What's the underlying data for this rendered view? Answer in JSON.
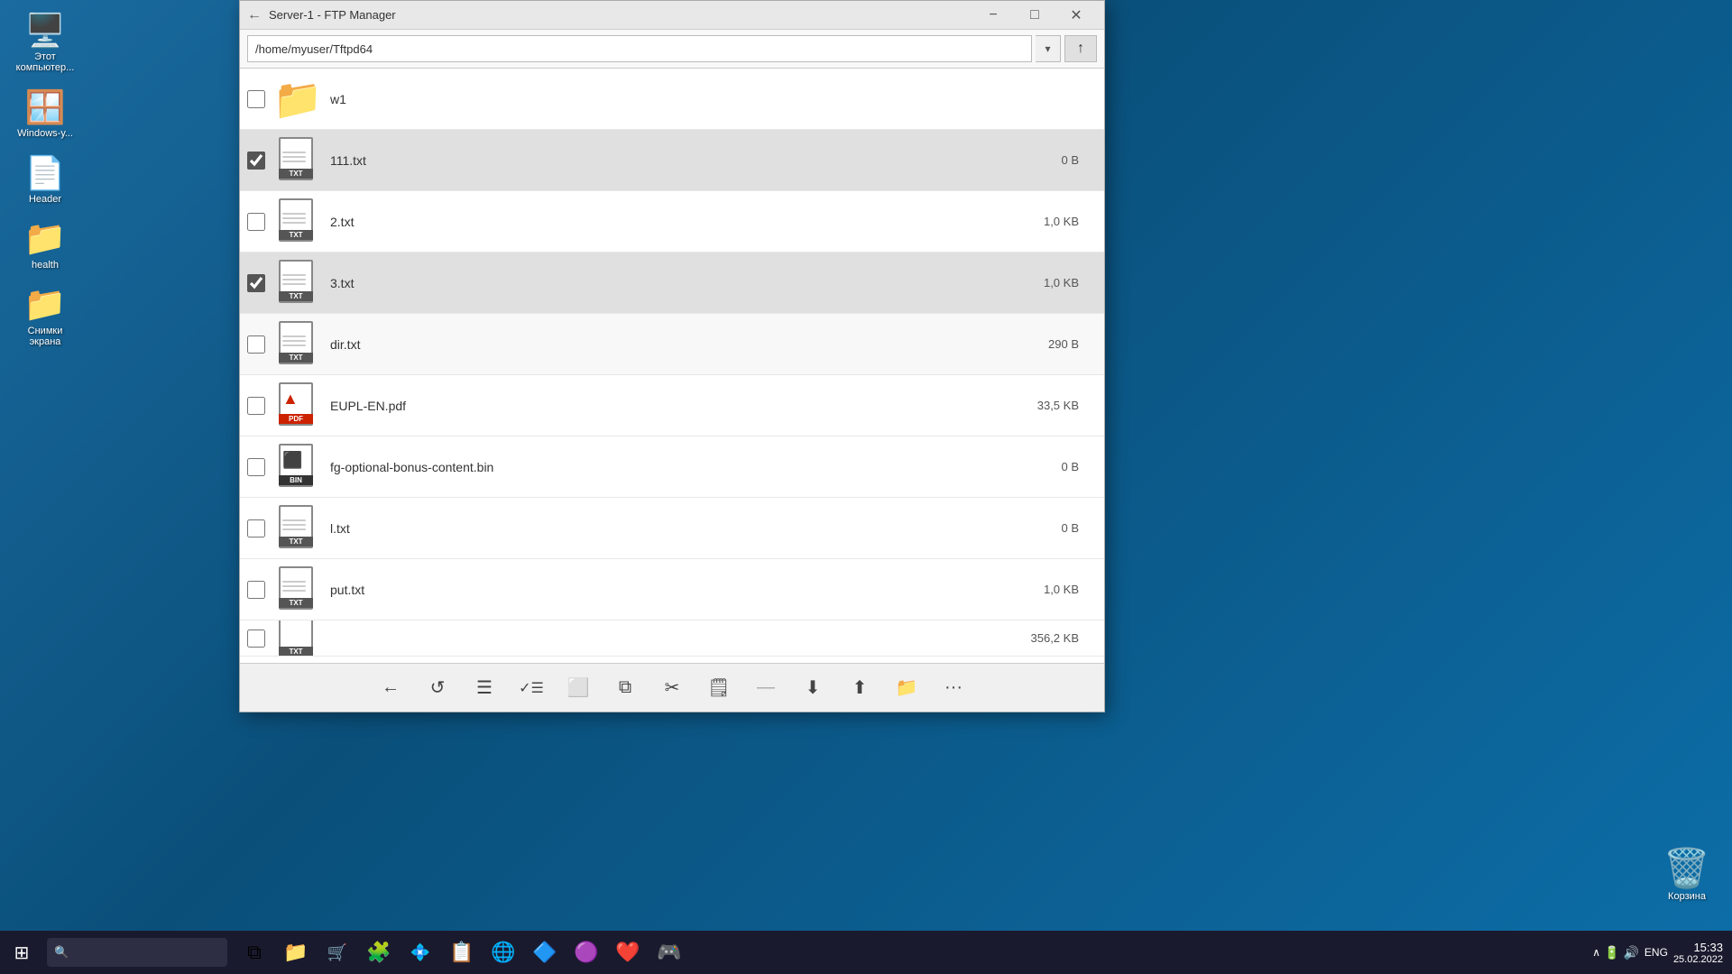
{
  "desktop": {
    "icons": [
      {
        "id": "computer",
        "label": "Этот\nкомпьютер...",
        "emoji": "🖥️"
      },
      {
        "id": "windows",
        "label": "Windows-у...",
        "emoji": "🪟"
      },
      {
        "id": "header",
        "label": "Header",
        "emoji": "📄"
      },
      {
        "id": "health",
        "label": "health",
        "emoji": "📁"
      },
      {
        "id": "screenshots",
        "label": "Снимки\nэкрана",
        "emoji": "📁"
      }
    ],
    "recycle_bin": {
      "label": "Корзина",
      "emoji": "🗑️"
    }
  },
  "taskbar": {
    "start_icon": "⊞",
    "search_placeholder": "🔍",
    "apps": [
      {
        "id": "taskview",
        "emoji": "⧉"
      },
      {
        "id": "explorer",
        "emoji": "📁"
      },
      {
        "id": "store",
        "emoji": "🛍️"
      },
      {
        "id": "app1",
        "emoji": "🧩"
      },
      {
        "id": "app2",
        "emoji": "💠"
      },
      {
        "id": "app3",
        "emoji": "📋"
      },
      {
        "id": "browser",
        "emoji": "🌐"
      },
      {
        "id": "vscode",
        "emoji": "🔷"
      },
      {
        "id": "vs",
        "emoji": "🟣"
      },
      {
        "id": "app4",
        "emoji": "❤️"
      },
      {
        "id": "app5",
        "emoji": "🎮"
      }
    ],
    "tray": {
      "lang": "ENG",
      "time": "15:33",
      "date": "25.02.2022"
    }
  },
  "window": {
    "title": "Server-1 - FTP Manager",
    "address": "/home/myuser/Tftpd64",
    "files": [
      {
        "id": "w1",
        "name": "w1",
        "type": "folder",
        "size": "",
        "checked": false,
        "alt": false
      },
      {
        "id": "111txt",
        "name": "111.txt",
        "type": "txt",
        "size": "0 B",
        "checked": true,
        "alt": true
      },
      {
        "id": "2txt",
        "name": "2.txt",
        "type": "txt",
        "size": "1,0 KB",
        "checked": false,
        "alt": false
      },
      {
        "id": "3txt",
        "name": "3.txt",
        "type": "txt",
        "size": "1,0 KB",
        "checked": true,
        "alt": true
      },
      {
        "id": "dirtxt",
        "name": "dir.txt",
        "type": "txt",
        "size": "290 B",
        "checked": false,
        "alt": false
      },
      {
        "id": "eupl",
        "name": "EUPL-EN.pdf",
        "type": "pdf",
        "size": "33,5 KB",
        "checked": false,
        "alt": false
      },
      {
        "id": "fgbin",
        "name": "fg-optional-bonus-content.bin",
        "type": "bin",
        "size": "0 B",
        "checked": false,
        "alt": false
      },
      {
        "id": "ltxt",
        "name": "l.txt",
        "type": "txt",
        "size": "0 B",
        "checked": false,
        "alt": false
      },
      {
        "id": "puttxt",
        "name": "put.txt",
        "type": "txt",
        "size": "1,0 KB",
        "checked": false,
        "alt": false
      },
      {
        "id": "partial",
        "name": "",
        "type": "txt",
        "size": "356,2 KB",
        "checked": false,
        "alt": false
      }
    ],
    "toolbar_buttons": [
      {
        "id": "back",
        "symbol": "←"
      },
      {
        "id": "refresh",
        "symbol": "↺"
      },
      {
        "id": "list",
        "symbol": "≡"
      },
      {
        "id": "checklist",
        "symbol": "✓≡"
      },
      {
        "id": "copy-to",
        "symbol": "⬜"
      },
      {
        "id": "paste",
        "symbol": "📋"
      },
      {
        "id": "cut",
        "symbol": "✂"
      },
      {
        "id": "rename",
        "symbol": "📝"
      },
      {
        "id": "separator",
        "symbol": "—"
      },
      {
        "id": "download",
        "symbol": "⬇"
      },
      {
        "id": "upload",
        "symbol": "⬆"
      },
      {
        "id": "new-folder",
        "symbol": "📁"
      },
      {
        "id": "more",
        "symbol": "…"
      }
    ]
  }
}
